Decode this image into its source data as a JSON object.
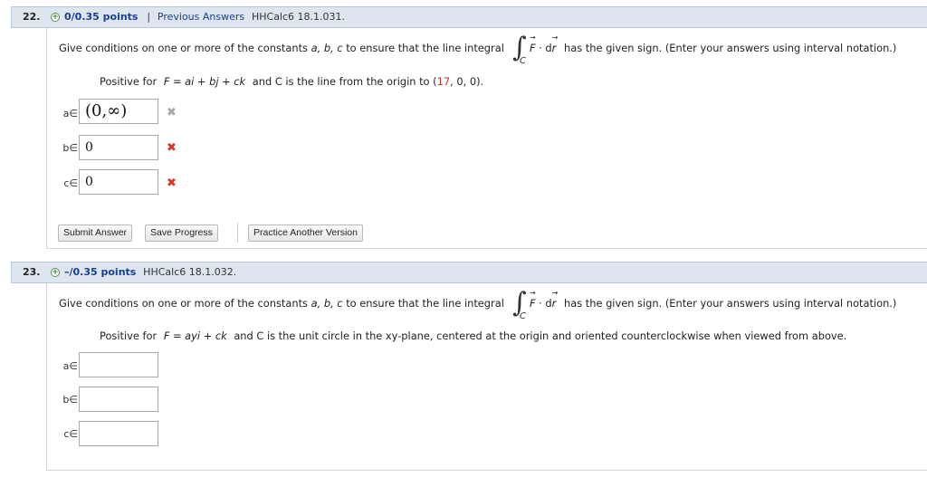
{
  "q22": {
    "number": "22.",
    "points": "0/0.35 points",
    "separator": "|",
    "previous_answers": "Previous Answers",
    "code": "HHCalc6 18.1.031.",
    "prompt_before": "Give conditions on one or more of the constants",
    "prompt_vars": "a, b, c",
    "prompt_mid": "to ensure that the line integral",
    "prompt_after": "has the given sign. (Enter your answers using interval notation.)",
    "cond_prefix": "Positive for",
    "cond_field": "F = ai + bj + ck",
    "cond_middle": "and C is the line from the origin to (",
    "cond_point_x": "17",
    "cond_point_rest": ", 0, 0).",
    "rows": [
      {
        "label": "a∈",
        "value": "(0,∞)",
        "mark": "✖",
        "mark_state": "incorrect-gray"
      },
      {
        "label": "b∈",
        "value": "0",
        "mark": "✖",
        "mark_state": "incorrect"
      },
      {
        "label": "c∈",
        "value": "0",
        "mark": "✖",
        "mark_state": "incorrect"
      }
    ],
    "buttons": {
      "submit": "Submit Answer",
      "save": "Save Progress",
      "practice": "Practice Another Version"
    }
  },
  "q23": {
    "number": "23.",
    "points": "–/0.35 points",
    "code": "HHCalc6 18.1.032.",
    "prompt_before": "Give conditions on one or more of the constants",
    "prompt_vars": "a, b, c",
    "prompt_mid": "to ensure that the line integral",
    "prompt_after": "has the given sign. (Enter your answers using interval notation.)",
    "cond_prefix": "Positive for",
    "cond_field": "F = ayi + ck",
    "cond_text": "and C is the unit circle in the xy-plane, centered at the origin and oriented counterclockwise when viewed from above.",
    "rows": [
      {
        "label": "a∈",
        "value": ""
      },
      {
        "label": "b∈",
        "value": ""
      },
      {
        "label": "c∈",
        "value": ""
      }
    ]
  },
  "colors": {
    "header_bg": "#dde6ef",
    "link_blue": "#1a3f8f",
    "error_red": "#d9342b",
    "highlight_red": "#c8322a"
  }
}
